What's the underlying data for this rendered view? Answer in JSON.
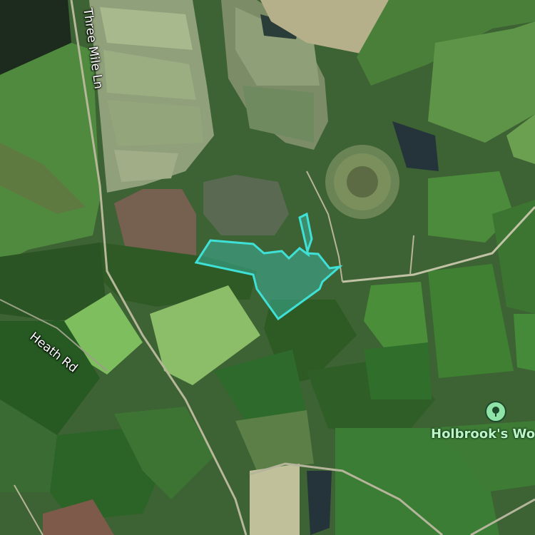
{
  "map": {
    "type": "satellite",
    "highlight_color": "#3fe0d6"
  },
  "roads": {
    "three_mile_ln": "Three Mile Ln",
    "heath_rd": "Heath Rd"
  },
  "poi": {
    "name": "Holbrook's Wo",
    "icon": "tree-icon",
    "color": "#8fe3a8"
  }
}
